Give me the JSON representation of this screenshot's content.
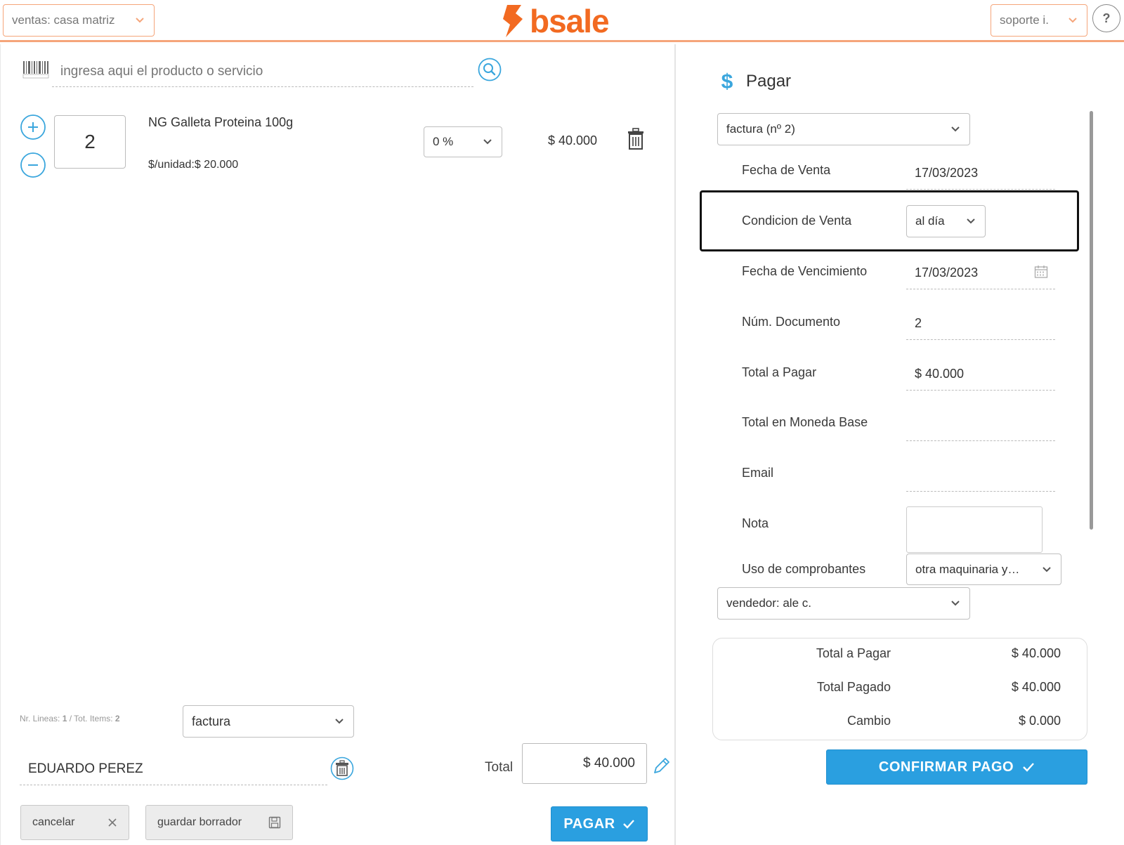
{
  "header": {
    "branch_select": "ventas: casa matriz",
    "logo_text": "bsale",
    "user_select": "soporte i.",
    "help_label": "?"
  },
  "search": {
    "placeholder": "ingresa aqui el producto o servicio"
  },
  "cart": {
    "items": [
      {
        "qty": "2",
        "name": "NG Galleta Proteina 100g",
        "unit_price": "$/unidad:$ 20.000",
        "discount": "0 %",
        "total": "$ 40.000"
      }
    ]
  },
  "footer": {
    "summary_prefix": "Nr. Lineas: ",
    "lines": "1",
    "summary_mid": " / Tot. Items: ",
    "items": "2",
    "doc_type": "factura",
    "client": "EDUARDO PEREZ",
    "total_label": "Total",
    "total_value": "$ 40.000",
    "cancel_label": "cancelar",
    "draft_label": "guardar borrador",
    "pay_label": "PAGAR"
  },
  "payment": {
    "title": "Pagar",
    "doc_select": "factura (nº 2)",
    "fields": {
      "sale_date_label": "Fecha de Venta",
      "sale_date": "17/03/2023",
      "condition_label": "Condicion de Venta",
      "condition": "al día",
      "due_date_label": "Fecha de Vencimiento",
      "due_date": "17/03/2023",
      "doc_num_label": "Núm. Documento",
      "doc_num": "2",
      "total_label": "Total a Pagar",
      "total": "$ 40.000",
      "base_total_label": "Total en Moneda Base",
      "email_label": "Email",
      "note_label": "Nota",
      "usage_label": "Uso de comprobantes",
      "usage": "otra maquinaria y…"
    },
    "seller_select": "vendedor: ale c.",
    "summary": {
      "total_label": "Total a Pagar",
      "total": "$ 40.000",
      "paid_label": "Total Pagado",
      "paid": "$ 40.000",
      "change_label": "Cambio",
      "change": "$ 0.000"
    },
    "confirm_label": "CONFIRMAR PAGO"
  },
  "colors": {
    "accent": "#f26a21",
    "blue": "#2a9fe0",
    "icon_blue": "#3aa6dd"
  }
}
